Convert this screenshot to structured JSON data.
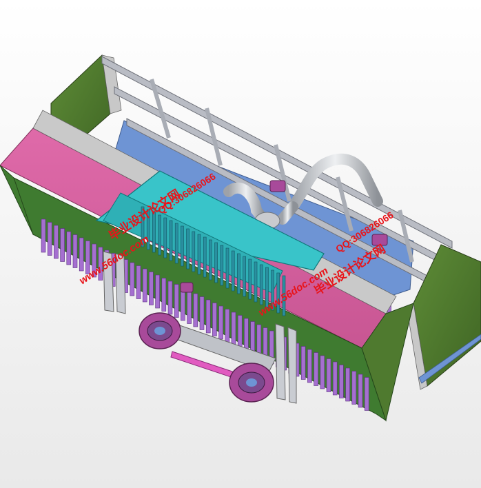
{
  "viewport": {
    "background": "#f2f2f2",
    "model": {
      "colors": {
        "frame_green": "#4f7a2f",
        "frame_green_dark": "#3d6024",
        "side_green": "#3f7b30",
        "bed_blue": "#6e94d4",
        "magenta_panel": "#d5609f",
        "cyan_tray": "#39c4c9",
        "purple_slats": "#a56fd0",
        "rail_gray": "#b9bcc4",
        "pipe_gray": "#c9cbcf",
        "wheel_magenta": "#a84a9a"
      },
      "parts": [
        "green-side-frame",
        "rail-ladder",
        "conveyor-bed",
        "magenta-cover",
        "cyan-tray",
        "slat-rows",
        "suction-pipe",
        "drive-wheels",
        "support-legs"
      ]
    },
    "watermarks": [
      {
        "id": "wm1-cn",
        "text": "毕业设计论文网"
      },
      {
        "id": "wm1-url",
        "text": "www.56doc.com"
      },
      {
        "id": "wm1-qq",
        "text": "QQ:306826066"
      },
      {
        "id": "wm2-cn",
        "text": "毕业设计论文网"
      },
      {
        "id": "wm2-url",
        "text": "www.56doc.com"
      },
      {
        "id": "wm2-qq",
        "text": "QQ:306826066"
      }
    ]
  }
}
